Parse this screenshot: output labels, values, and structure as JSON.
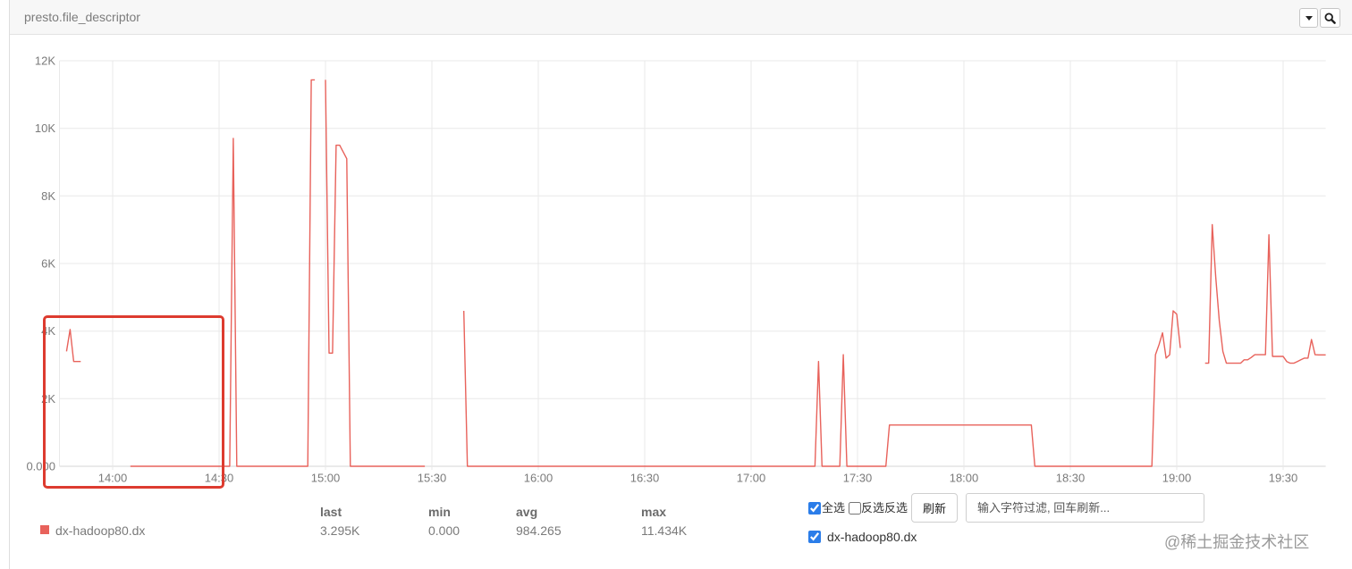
{
  "panel": {
    "dropdown_icon": "caret-down-icon",
    "zoom_icon": "search-icon",
    "header_background": "#f7f7f7"
  },
  "chart_data": {
    "type": "line",
    "title": "presto.file_descriptor",
    "x_ticks": [
      "14:00",
      "14:30",
      "15:00",
      "15:30",
      "16:00",
      "16:30",
      "17:00",
      "17:30",
      "18:00",
      "18:30",
      "19:00",
      "19:30"
    ],
    "y_ticks": [
      0,
      2000,
      4000,
      6000,
      8000,
      10000,
      12000
    ],
    "y_tick_labels": [
      "0.000",
      "2K",
      "4K",
      "6K",
      "8K",
      "10K",
      "12K"
    ],
    "xlim": [
      "13:45",
      "19:42"
    ],
    "ylim": [
      0,
      12000
    ],
    "grid": true,
    "legend_position": "bottom-left",
    "series": [
      {
        "name": "dx-hadoop80.dx",
        "color": "#e8625b",
        "points": [
          [
            "13:47",
            3400
          ],
          [
            "13:48",
            4050
          ],
          [
            "13:49",
            3100
          ],
          [
            "13:50",
            3100
          ],
          [
            "13:51",
            3100
          ],
          [
            "13:52",
            null
          ],
          [
            "14:05",
            0
          ],
          [
            "14:33",
            0
          ],
          [
            "14:34",
            9700
          ],
          [
            "14:35",
            0
          ],
          [
            "14:55",
            0
          ],
          [
            "14:56",
            11434
          ],
          [
            "14:57",
            11434
          ],
          [
            "14:58",
            null
          ],
          [
            "15:00",
            11434
          ],
          [
            "15:01",
            3350
          ],
          [
            "15:02",
            3350
          ],
          [
            "15:03",
            9500
          ],
          [
            "15:04",
            9500
          ],
          [
            "15:05",
            9300
          ],
          [
            "15:06",
            9100
          ],
          [
            "15:07",
            0
          ],
          [
            "15:28",
            0
          ],
          [
            "15:29",
            null
          ],
          [
            "15:39",
            4600
          ],
          [
            "15:40",
            0
          ],
          [
            "17:18",
            0
          ],
          [
            "17:19",
            3100
          ],
          [
            "17:20",
            0
          ],
          [
            "17:25",
            0
          ],
          [
            "17:26",
            3300
          ],
          [
            "17:27",
            0
          ],
          [
            "17:38",
            0
          ],
          [
            "17:39",
            1220
          ],
          [
            "18:19",
            1220
          ],
          [
            "18:20",
            0
          ],
          [
            "18:53",
            0
          ],
          [
            "18:54",
            3300
          ],
          [
            "18:55",
            3600
          ],
          [
            "18:56",
            3950
          ],
          [
            "18:57",
            3200
          ],
          [
            "18:58",
            3300
          ],
          [
            "18:59",
            4600
          ],
          [
            "19:00",
            4500
          ],
          [
            "19:01",
            3500
          ],
          [
            "19:02",
            null
          ],
          [
            "19:08",
            3050
          ],
          [
            "19:09",
            3050
          ],
          [
            "19:10",
            7150
          ],
          [
            "19:11",
            5600
          ],
          [
            "19:12",
            4300
          ],
          [
            "19:13",
            3400
          ],
          [
            "19:14",
            3050
          ],
          [
            "19:18",
            3050
          ],
          [
            "19:19",
            3150
          ],
          [
            "19:20",
            3150
          ],
          [
            "19:21",
            3220
          ],
          [
            "19:22",
            3300
          ],
          [
            "19:25",
            3300
          ],
          [
            "19:26",
            6850
          ],
          [
            "19:27",
            3250
          ],
          [
            "19:30",
            3250
          ],
          [
            "19:31",
            3100
          ],
          [
            "19:32",
            3050
          ],
          [
            "19:33",
            3050
          ],
          [
            "19:34",
            3100
          ],
          [
            "19:35",
            3150
          ],
          [
            "19:36",
            3200
          ],
          [
            "19:37",
            3200
          ],
          [
            "19:38",
            3750
          ],
          [
            "19:39",
            3300
          ],
          [
            "19:40",
            3295
          ],
          [
            "19:42",
            3295
          ]
        ]
      }
    ]
  },
  "stats": {
    "columns": [
      "last",
      "min",
      "avg",
      "max"
    ],
    "values": [
      "3.295K",
      "0.000",
      "984.265",
      "11.434K"
    ]
  },
  "controls": {
    "select_all": {
      "label": "全选",
      "checked": true
    },
    "invert": {
      "label": "反选反选",
      "checked": false
    },
    "refresh_label": "刷新",
    "filter_placeholder": "输入字符过滤, 回车刷新...",
    "series_filter": [
      {
        "label": "dx-hadoop80.dx",
        "checked": true
      }
    ]
  },
  "annotation": {
    "color": "#dd3b2f"
  },
  "watermark": "@稀土掘金技术社区"
}
